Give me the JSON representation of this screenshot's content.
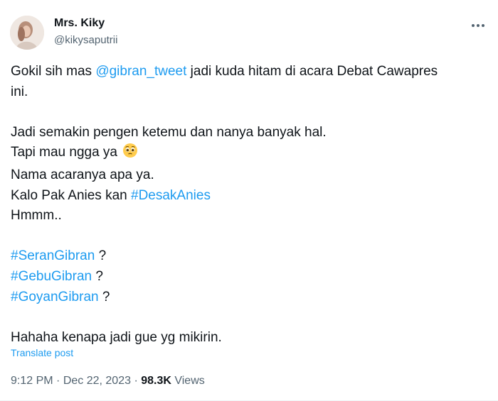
{
  "author": {
    "display_name": "Mrs. Kiky",
    "handle": "@kikysaputrii"
  },
  "tweet": {
    "lines": [
      {
        "parts": [
          {
            "text": "Gokil sih mas "
          },
          {
            "text": "@gibran_tweet",
            "link": true
          },
          {
            "text": " jadi kuda hitam di acara Debat Cawapres"
          }
        ]
      },
      {
        "parts": [
          {
            "text": "ini."
          }
        ]
      },
      {
        "blank": true
      },
      {
        "parts": [
          {
            "text": "Jadi semakin pengen ketemu dan nanya banyak hal."
          }
        ]
      },
      {
        "parts": [
          {
            "text": "Tapi mau ngga ya "
          }
        ],
        "emoji": "pleading-face-emoji"
      },
      {
        "parts": [
          {
            "text": "Nama acaranya apa ya."
          }
        ]
      },
      {
        "parts": [
          {
            "text": "Kalo Pak Anies kan "
          },
          {
            "text": "#DesakAnies",
            "link": true
          }
        ]
      },
      {
        "parts": [
          {
            "text": "Hmmm.."
          }
        ]
      },
      {
        "blank": true
      },
      {
        "parts": [
          {
            "text": "#SeranGibran",
            "link": true
          },
          {
            "text": " ?"
          }
        ]
      },
      {
        "parts": [
          {
            "text": "#GebuGibran",
            "link": true
          },
          {
            "text": " ?"
          }
        ]
      },
      {
        "parts": [
          {
            "text": "#GoyanGibran",
            "link": true
          },
          {
            "text": " ?"
          }
        ]
      },
      {
        "blank": true
      },
      {
        "parts": [
          {
            "text": "Hahaha kenapa jadi gue yg mikirin."
          }
        ]
      }
    ],
    "translate_label": "Translate post"
  },
  "meta": {
    "time": "9:12 PM",
    "separator1": " · ",
    "date": "Dec 22, 2023",
    "separator2": " · ",
    "views_count": "98.3K",
    "views_label": " Views"
  },
  "colors": {
    "link": "#1d9bf0",
    "text": "#0f1419",
    "secondary": "#536471"
  }
}
